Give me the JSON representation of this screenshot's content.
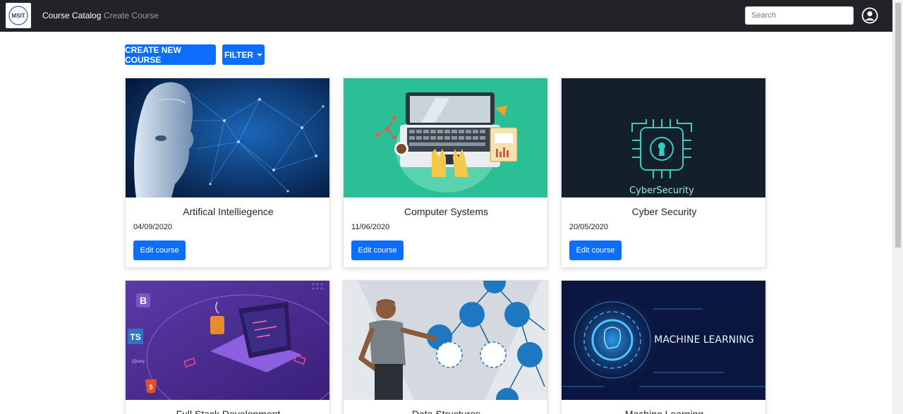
{
  "navbar": {
    "logo_text": "MSIT",
    "links": [
      "Course Catalog",
      "Create Course"
    ],
    "search_placeholder": "Search"
  },
  "toolbar": {
    "create_label": "CREATE NEW COURSE",
    "filter_label": "FILTER"
  },
  "courses": [
    {
      "title": "Artifical Intelliegence",
      "date": "04/09/2020",
      "button": "Edit course"
    },
    {
      "title": "Computer Systems",
      "date": "11/06/2020",
      "button": "Edit course"
    },
    {
      "title": "Cyber Security",
      "date": "20/05/2020",
      "button": "Edit course"
    },
    {
      "title": "Full Stack Development",
      "date": "",
      "button": ""
    },
    {
      "title": "Data Structures",
      "date": "",
      "button": ""
    },
    {
      "title": "Machine Learning",
      "date": "",
      "button": ""
    }
  ],
  "image_text": {
    "cyber": "CyberSecurity",
    "ml": "MACHINE LEARNING",
    "fullstack_b": "B",
    "fullstack_ts": "TS",
    "fullstack_jquery": "jQuery",
    "fullstack_html": "5"
  },
  "colors": {
    "navbar": "#222326",
    "primary": "#0d6efd",
    "computer_bg": "#2bbf96",
    "cyber_bg": "#13202a",
    "fullstack_bg": "#4b2f91",
    "ml_bg": "#0b1640"
  }
}
